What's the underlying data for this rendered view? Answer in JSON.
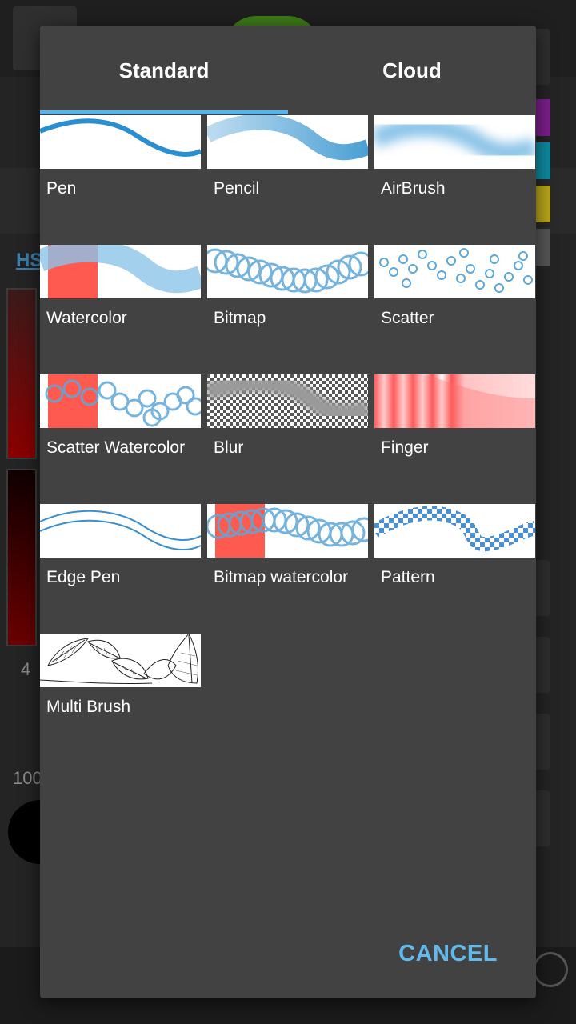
{
  "background": {
    "color_model_label": "HSV",
    "size_value": "4",
    "opacity_value": "100"
  },
  "dialog": {
    "tabs": [
      {
        "label": "Standard",
        "selected": true
      },
      {
        "label": "Cloud",
        "selected": false
      }
    ],
    "brushes": [
      {
        "label": "Pen",
        "icon": "pen-stroke-preview"
      },
      {
        "label": "Pencil",
        "icon": "pencil-stroke-preview"
      },
      {
        "label": "AirBrush",
        "icon": "airbrush-stroke-preview"
      },
      {
        "label": "Watercolor",
        "icon": "watercolor-stroke-preview"
      },
      {
        "label": "Bitmap",
        "icon": "bitmap-stroke-preview"
      },
      {
        "label": "Scatter",
        "icon": "scatter-stroke-preview"
      },
      {
        "label": "Scatter Watercolor",
        "icon": "scatter-watercolor-stroke-preview"
      },
      {
        "label": "Blur",
        "icon": "blur-stroke-preview"
      },
      {
        "label": "Finger",
        "icon": "finger-stroke-preview"
      },
      {
        "label": "Edge Pen",
        "icon": "edge-pen-stroke-preview"
      },
      {
        "label": "Bitmap watercolor",
        "icon": "bitmap-watercolor-stroke-preview"
      },
      {
        "label": "Pattern",
        "icon": "pattern-stroke-preview"
      },
      {
        "label": "Multi Brush",
        "icon": "multi-brush-stroke-preview"
      }
    ],
    "cancel_label": "CANCEL"
  },
  "colors": {
    "accent": "#59b3e6",
    "cancel": "#62b9ec",
    "dialog_bg": "#424242",
    "stroke_blue": "#4a9fd4",
    "watercolor_red": "#ff5a4f"
  }
}
